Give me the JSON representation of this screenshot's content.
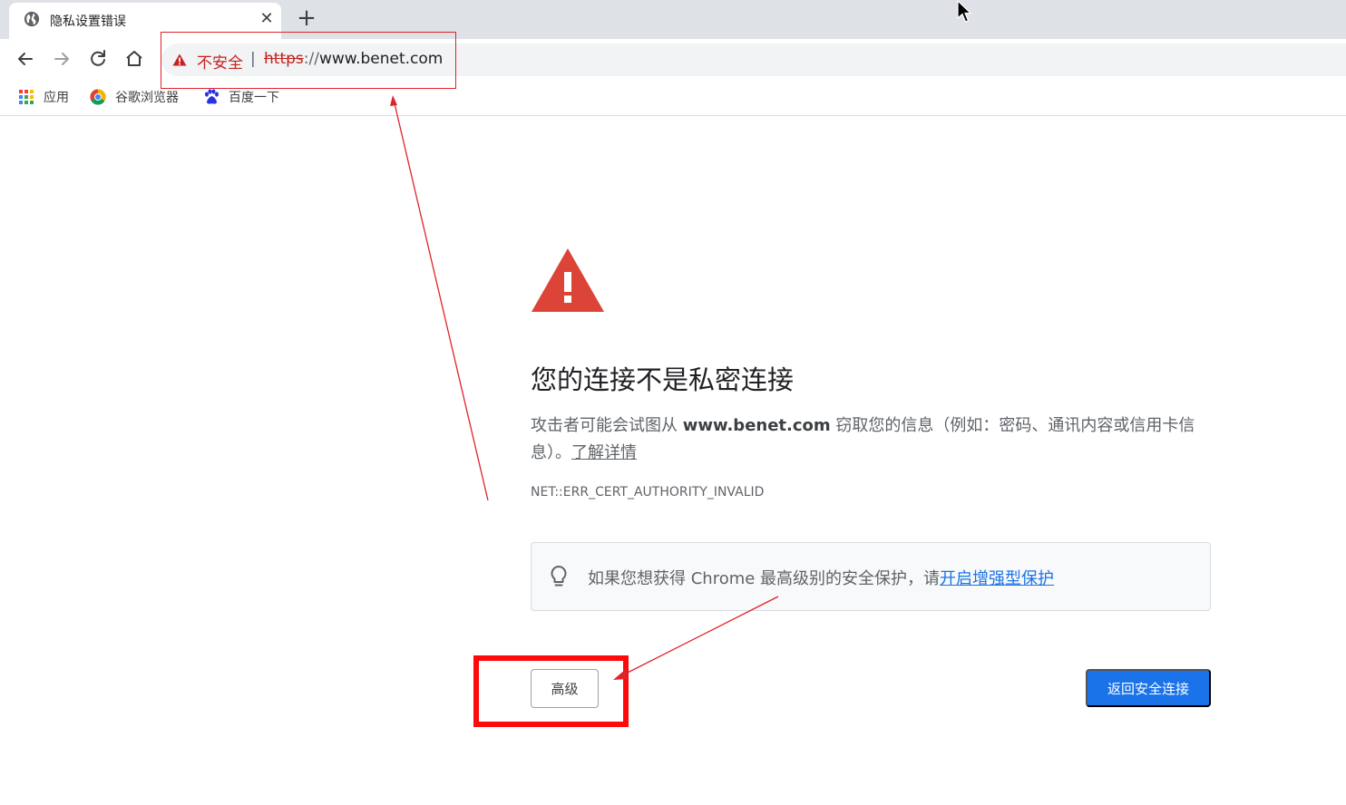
{
  "tab": {
    "title": "隐私设置错误",
    "close_glyph": "✕",
    "icon": "globe-icon"
  },
  "new_tab_glyph": "+",
  "toolbar": {
    "back_icon": "arrow-left-icon",
    "forward_icon": "arrow-right-icon",
    "reload_icon": "reload-icon",
    "home_icon": "home-icon"
  },
  "omnibox": {
    "security_label": "不安全",
    "separator": "|",
    "url_scheme": "https",
    "url_separator": "://",
    "url_host": "www.benet.com"
  },
  "bookmarks": [
    {
      "label": "应用",
      "icon": "apps-grid-icon"
    },
    {
      "label": "谷歌浏览器",
      "icon": "chrome-icon"
    },
    {
      "label": "百度一下",
      "icon": "baidu-paw-icon"
    }
  ],
  "interstitial": {
    "headline": "您的连接不是私密连接",
    "explain_prefix": "攻击者可能会试图从 ",
    "explain_host": "www.benet.com",
    "explain_suffix": " 窃取您的信息（例如：密码、通讯内容或信用卡信息）。",
    "learn_more": "了解详情",
    "error_code": "NET::ERR_CERT_AUTHORITY_INVALID",
    "tip_text": "如果您想获得 Chrome 最高级别的安全保护，请",
    "tip_link": "开启增强型保护",
    "advanced_button": "高级",
    "back_button": "返回安全连接"
  },
  "colors": {
    "danger": "#c5221f",
    "warning_triangle": "#db4437",
    "primary_button": "#1a73e8",
    "annotation_red": "#ff0a0a"
  }
}
